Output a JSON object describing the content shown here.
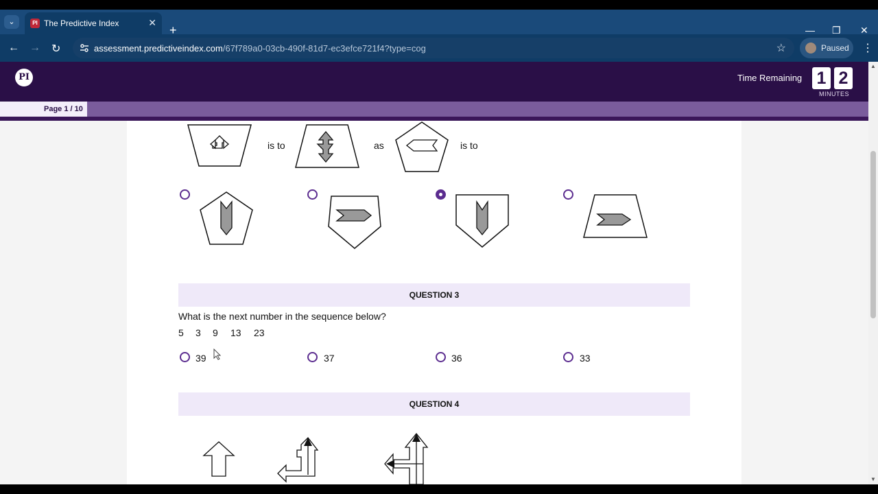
{
  "browser": {
    "tab_title": "The Predictive Index",
    "tab_favicon_text": "PI",
    "url_host": "assessment.predictiveindex.com",
    "url_path": "/67f789a0-03cb-490f-81d7-ec3efce721f4?type=cog",
    "profile_status": "Paused"
  },
  "header": {
    "logo_text": "PI",
    "time_label": "Time Remaining",
    "time_digit_1": "1",
    "time_digit_2": "2",
    "time_unit": "MINUTES"
  },
  "progress": {
    "page_label": "Page 1 / 10",
    "fraction": 0.1
  },
  "question2": {
    "analogy": [
      "is to",
      "as",
      "is to"
    ],
    "options_selected_index": 2
  },
  "question3": {
    "title": "QUESTION 3",
    "prompt": "What is the next number in the sequence below?",
    "sequence": [
      "5",
      "3",
      "9",
      "13",
      "23"
    ],
    "options": [
      "39",
      "37",
      "36",
      "33"
    ]
  },
  "question4": {
    "title": "QUESTION 4"
  },
  "colors": {
    "header_bg": "#2a0f47",
    "accent": "#5b2c8f",
    "question_bar": "#efe9f9"
  }
}
